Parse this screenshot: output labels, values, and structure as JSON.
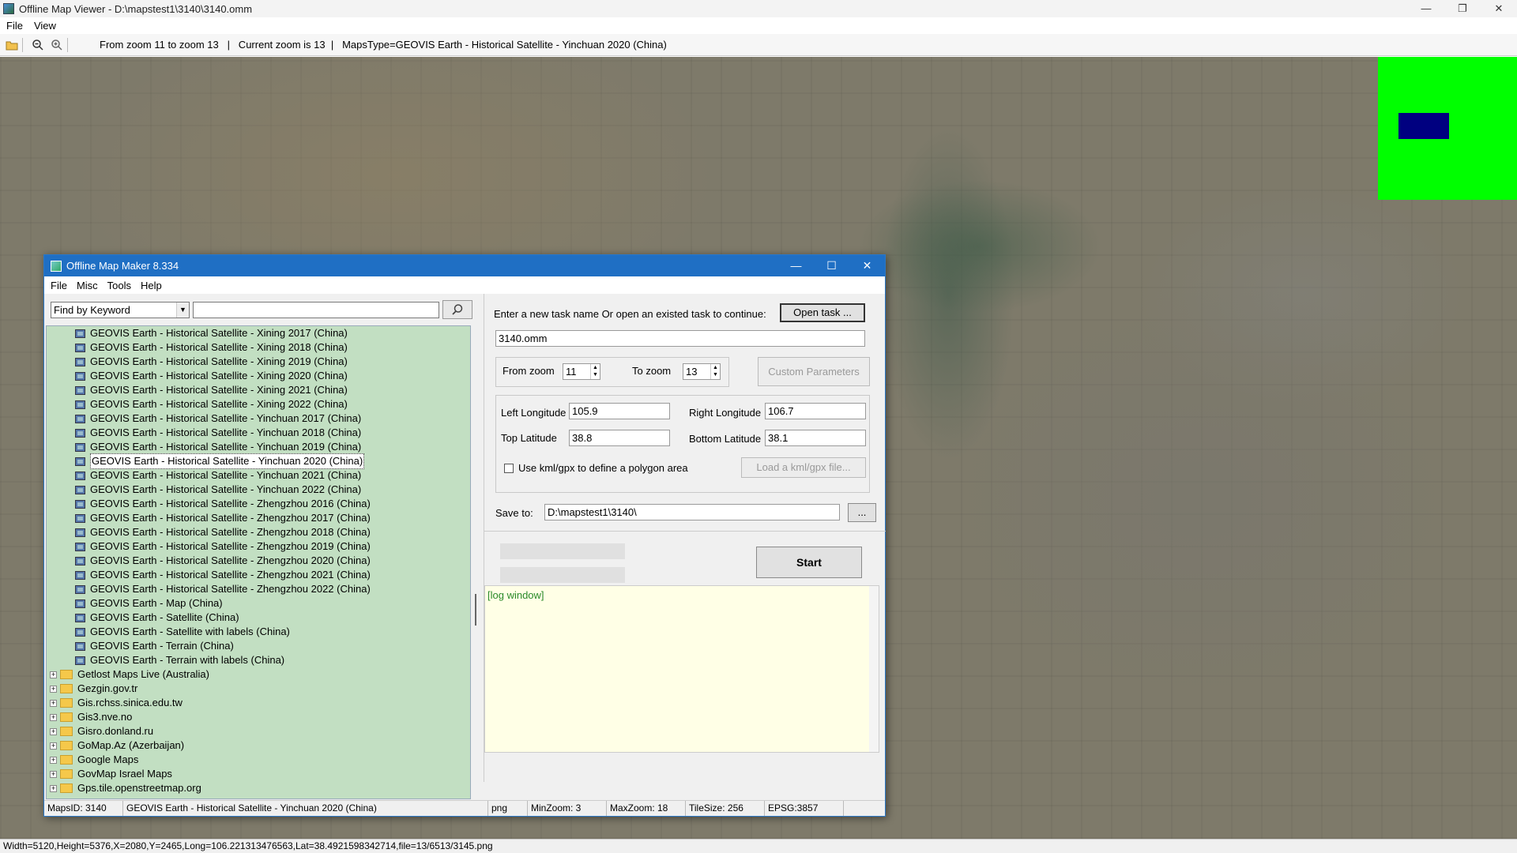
{
  "window": {
    "title": "Offline Map Viewer - D:\\mapstest1\\3140\\3140.omm",
    "minimize": "—",
    "maximize": "❐",
    "close": "✕"
  },
  "menu": {
    "file": "File",
    "view": "View"
  },
  "toolbar": {
    "status": "From zoom 11 to zoom 13   |   Current zoom is 13  |   MapsType=GEOVIS Earth - Historical Satellite - Yinchuan 2020 (China)"
  },
  "statusbar": {
    "text": "Width=5120,Height=5376,X=2080,Y=2465,Long=106.221313476563,Lat=38.4921598342714,file=13/6513/3145.png"
  },
  "overview": {
    "fill_color": "#00ff00",
    "viewport_color": "#000080"
  },
  "dialog": {
    "title": "Offline Map Maker 8.334",
    "menu": {
      "file": "File",
      "misc": "Misc",
      "tools": "Tools",
      "help": "Help"
    },
    "controls": {
      "minimize": "—",
      "maximize": "☐",
      "close": "✕"
    },
    "search": {
      "mode": "Find by Keyword",
      "value": ""
    },
    "tree": {
      "map_items": [
        "GEOVIS Earth - Historical Satellite - Xining 2017 (China)",
        "GEOVIS Earth - Historical Satellite - Xining 2018 (China)",
        "GEOVIS Earth - Historical Satellite - Xining 2019 (China)",
        "GEOVIS Earth - Historical Satellite - Xining 2020 (China)",
        "GEOVIS Earth - Historical Satellite - Xining 2021 (China)",
        "GEOVIS Earth - Historical Satellite - Xining 2022 (China)",
        "GEOVIS Earth - Historical Satellite - Yinchuan 2017 (China)",
        "GEOVIS Earth - Historical Satellite - Yinchuan 2018 (China)",
        "GEOVIS Earth - Historical Satellite - Yinchuan 2019 (China)",
        "GEOVIS Earth - Historical Satellite - Yinchuan 2020 (China)",
        "GEOVIS Earth - Historical Satellite - Yinchuan 2021 (China)",
        "GEOVIS Earth - Historical Satellite - Yinchuan 2022 (China)",
        "GEOVIS Earth - Historical Satellite - Zhengzhou 2016 (China)",
        "GEOVIS Earth - Historical Satellite - Zhengzhou 2017 (China)",
        "GEOVIS Earth - Historical Satellite - Zhengzhou 2018 (China)",
        "GEOVIS Earth - Historical Satellite - Zhengzhou 2019 (China)",
        "GEOVIS Earth - Historical Satellite - Zhengzhou 2020 (China)",
        "GEOVIS Earth - Historical Satellite - Zhengzhou 2021 (China)",
        "GEOVIS Earth - Historical Satellite - Zhengzhou 2022 (China)",
        "GEOVIS Earth - Map (China)",
        "GEOVIS Earth - Satellite (China)",
        "GEOVIS Earth - Satellite with labels (China)",
        "GEOVIS Earth - Terrain (China)",
        "GEOVIS Earth - Terrain with labels (China)"
      ],
      "selected": "GEOVIS Earth - Historical Satellite - Yinchuan 2020 (China)",
      "folders": [
        "Getlost Maps Live (Australia)",
        "Gezgin.gov.tr",
        "Gis.rchss.sinica.edu.tw",
        "Gis3.nve.no",
        "Gisro.donland.ru",
        "GoMap.Az (Azerbaijan)",
        "Google Maps",
        "GovMap Israel Maps",
        "Gps.tile.openstreetmap.org"
      ],
      "expander_symbol": "+"
    },
    "task": {
      "prompt": "Enter a new task name Or open an existed task to continue:",
      "open_button": "Open task ...",
      "name_value": "3140.omm"
    },
    "zoom": {
      "from_label": "From zoom",
      "from_value": "11",
      "to_label": "To zoom",
      "to_value": "13",
      "custom_button": "Custom Parameters"
    },
    "bounds": {
      "left_lon_label": "Left Longitude",
      "left_lon_value": "105.9",
      "right_lon_label": "Right Longitude",
      "right_lon_value": "106.7",
      "top_lat_label": "Top Latitude",
      "top_lat_value": "38.8",
      "bottom_lat_label": "Bottom Latitude",
      "bottom_lat_value": "38.1",
      "kml_label": "Use kml/gpx to define a polygon area",
      "kml_checked": false,
      "load_kml_button": "Load a kml/gpx file..."
    },
    "save": {
      "label": "Save to:",
      "path": "D:\\mapstest1\\3140\\",
      "browse_button": "..."
    },
    "start_button": "Start",
    "log": {
      "placeholder": "[log window]"
    },
    "status": {
      "maps_id": "MapsID: 3140",
      "maps_name": "GEOVIS Earth - Historical Satellite - Yinchuan 2020 (China)",
      "format": "png",
      "min_zoom": "MinZoom: 3",
      "max_zoom": "MaxZoom: 18",
      "tile_size": "TileSize: 256",
      "epsg": "EPSG:3857"
    }
  }
}
